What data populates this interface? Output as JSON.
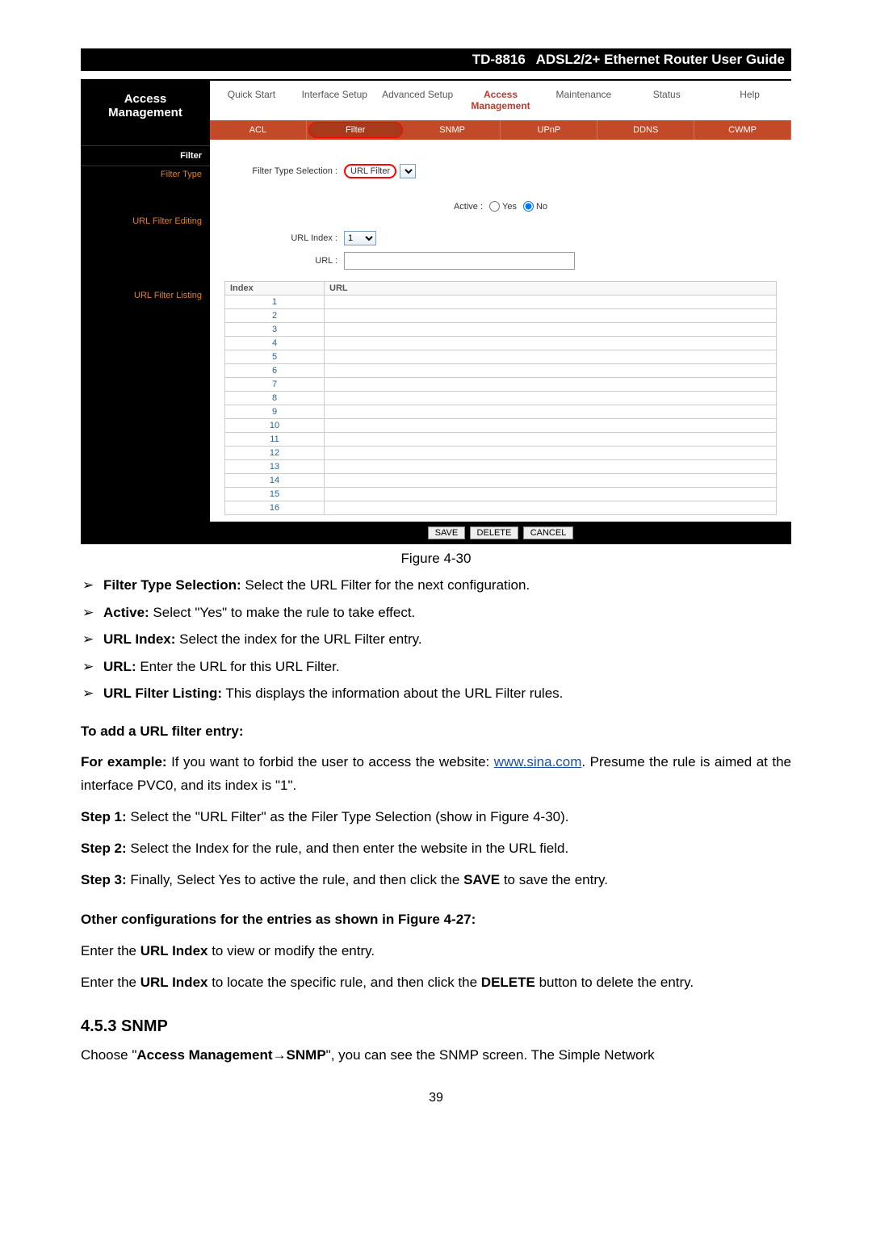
{
  "header": {
    "model": "TD-8816",
    "title": "ADSL2/2+ Ethernet Router User Guide"
  },
  "router": {
    "left_title": "Access Management",
    "left_labels": {
      "filter": "Filter",
      "filter_type": "Filter Type",
      "url_filter_editing": "URL Filter Editing",
      "url_filter_listing": "URL Filter Listing"
    },
    "topnav1": [
      "Quick Start",
      "Interface Setup",
      "Advanced Setup",
      "Access Management",
      "Maintenance",
      "Status",
      "Help"
    ],
    "topnav1_active_index": 3,
    "topnav2": [
      "ACL",
      "Filter",
      "SNMP",
      "UPnP",
      "DDNS",
      "CWMP"
    ],
    "topnav2_active_index": 1,
    "form": {
      "filter_type_label": "Filter Type Selection :",
      "filter_type_value": "URL Filter",
      "active_label": "Active :",
      "active_yes": "Yes",
      "active_no": "No",
      "url_index_label": "URL Index :",
      "url_index_value": "1",
      "url_label": "URL :"
    },
    "table": {
      "col_index": "Index",
      "col_url": "URL",
      "rows": [
        "1",
        "2",
        "3",
        "4",
        "5",
        "6",
        "7",
        "8",
        "9",
        "10",
        "11",
        "12",
        "13",
        "14",
        "15",
        "16"
      ]
    },
    "buttons": {
      "save": "SAVE",
      "delete": "DELETE",
      "cancel": "CANCEL"
    }
  },
  "caption": "Figure 4-30",
  "bullets": [
    {
      "label": "Filter Type Selection:",
      "text": " Select the URL Filter for the next configuration."
    },
    {
      "label": "Active:",
      "text": " Select \"Yes\" to make the rule to take effect."
    },
    {
      "label": "URL Index:",
      "text": " Select the index for the URL Filter entry."
    },
    {
      "label": "URL:",
      "text": " Enter the URL for this URL Filter."
    },
    {
      "label": "URL Filter Listing:",
      "text": " This displays the information about the URL Filter rules."
    }
  ],
  "add_heading": "To add a URL filter entry:",
  "example": {
    "prefix": "For example:",
    "before_link": " If you want to forbid the user to access the website: ",
    "link": "www.sina.com",
    "after_link": ". Presume the rule is aimed at the interface PVC0, and its index is \"1\"."
  },
  "steps": [
    {
      "label": "Step 1:",
      "text": " Select the \"URL Filter\" as the Filer Type Selection (show in Figure 4-30)."
    },
    {
      "label": "Step 2:",
      "text": " Select the Index for the rule, and then enter the website in the URL field."
    }
  ],
  "step3": {
    "label": "Step 3:",
    "before": " Finally, Select Yes to active the rule, and then click the ",
    "bold": "SAVE",
    "after": " to save the entry."
  },
  "other_heading": "Other configurations for the entries as shown in Figure 4-27:",
  "other1": {
    "before": "Enter the ",
    "bold": "URL Index",
    "after": " to view or modify the entry."
  },
  "other2": {
    "before": "Enter the ",
    "bold1": "URL Index",
    "mid": " to locate the specific rule, and then click the ",
    "bold2": "DELETE",
    "after": " button to delete the entry."
  },
  "snmp_heading": "4.5.3  SNMP",
  "snmp_para": {
    "before": "Choose \"",
    "bold1": "Access Management",
    "arrow": "→",
    "bold2": "SNMP",
    "after": "\", you can see the SNMP screen. The Simple Network"
  },
  "page_number": "39"
}
